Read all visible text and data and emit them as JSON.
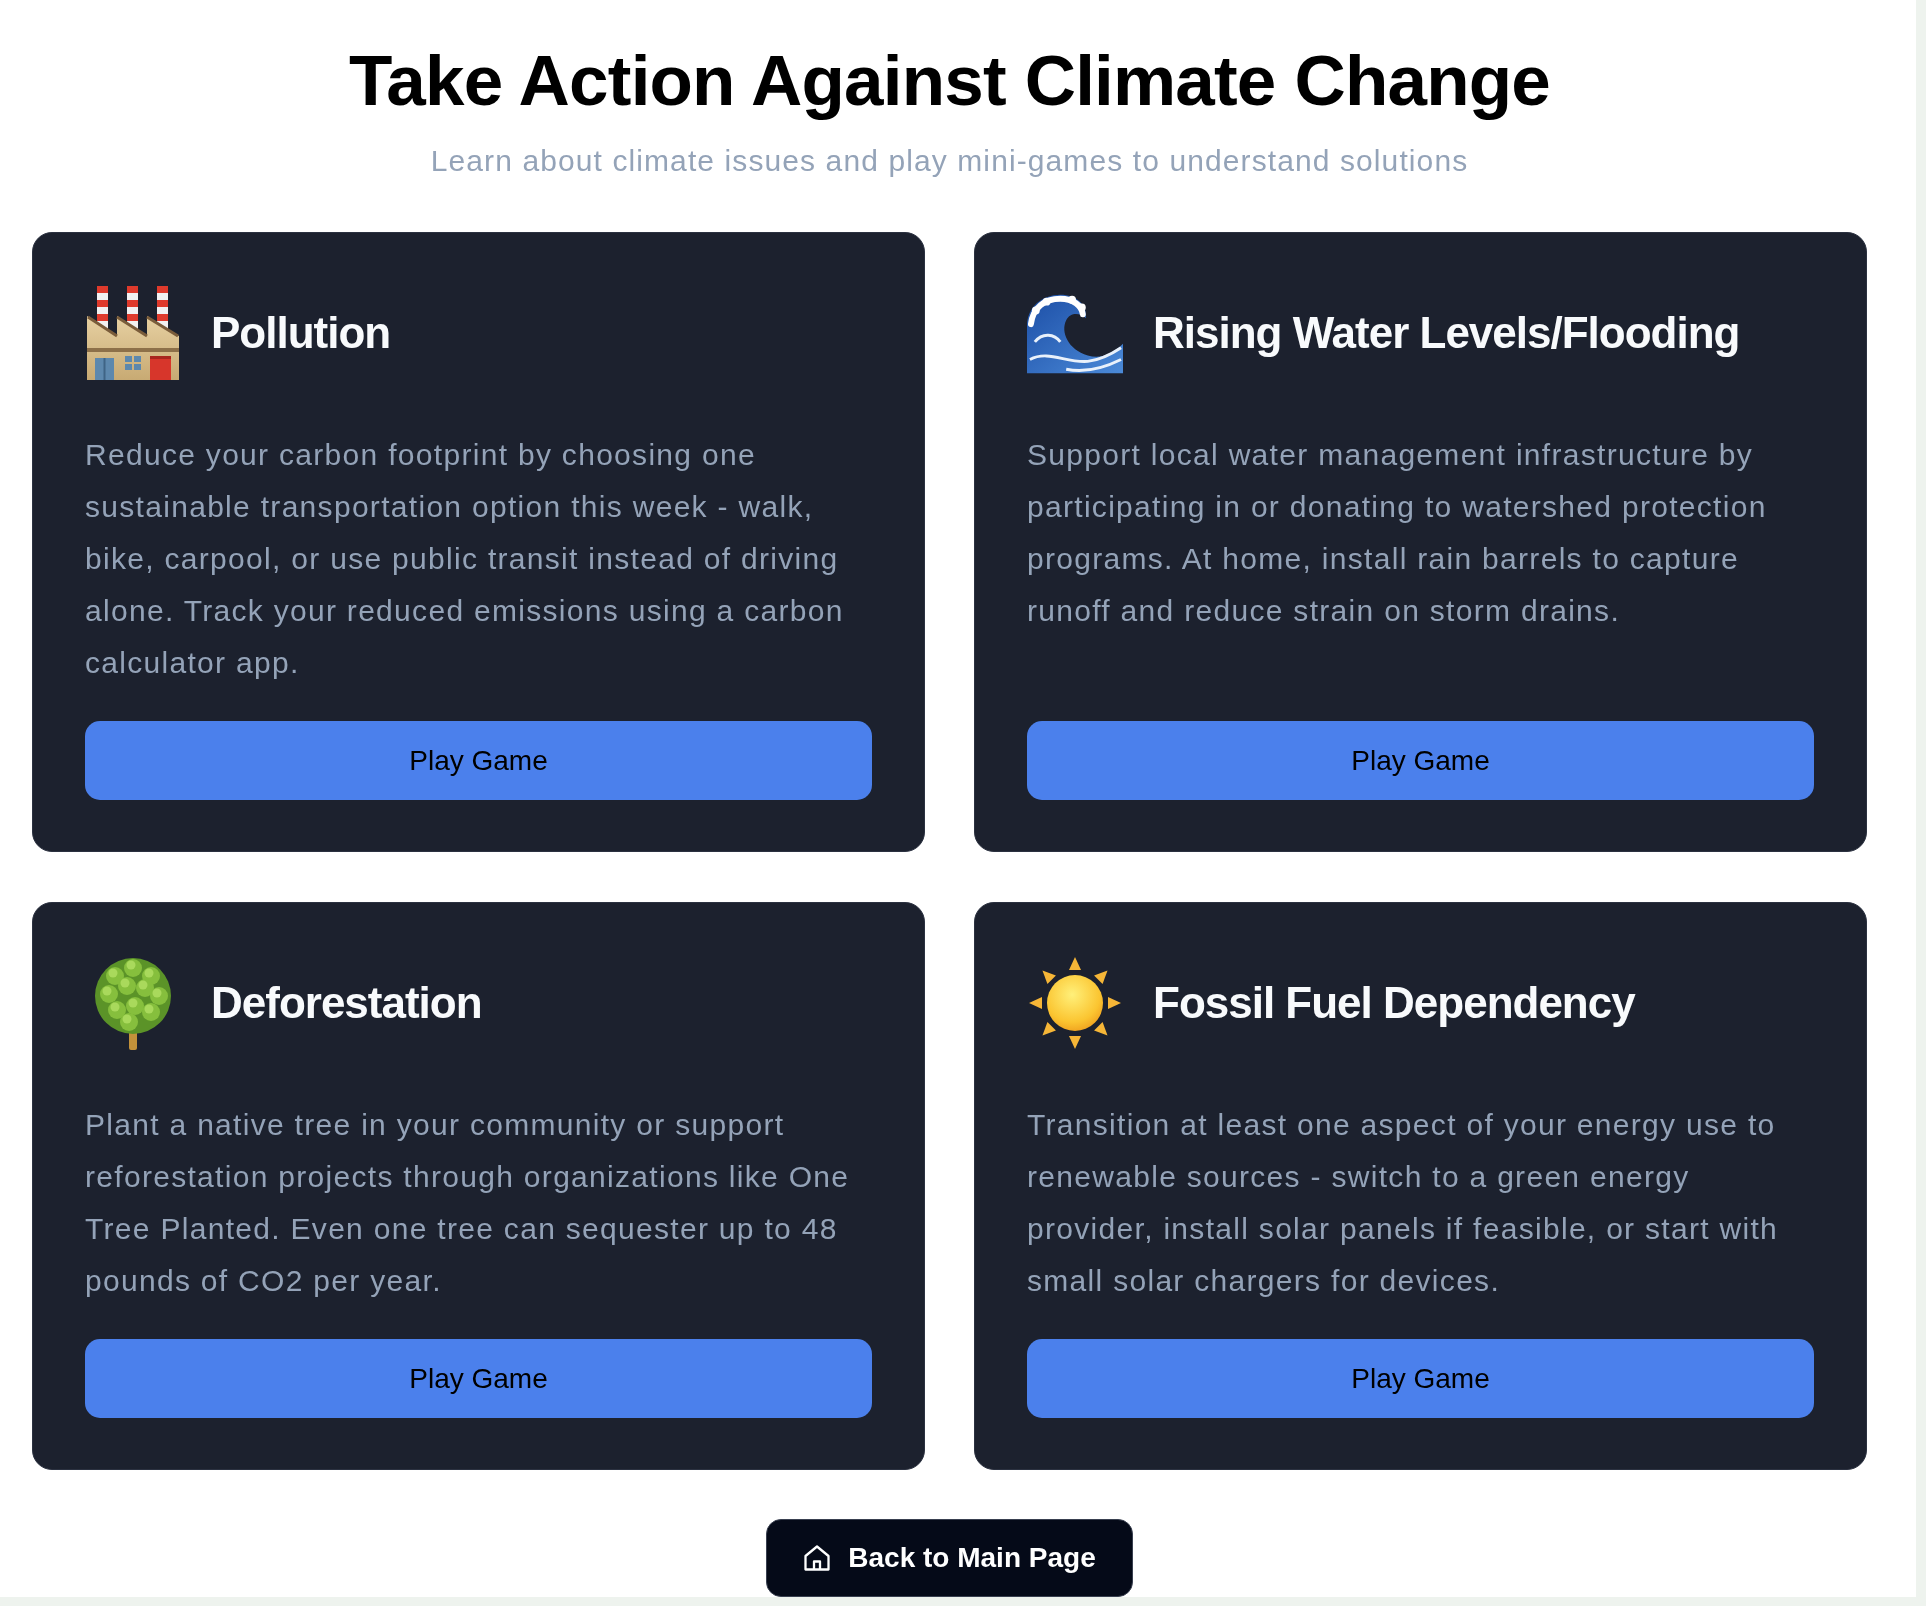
{
  "header": {
    "title": "Take Action Against Climate Change",
    "subtitle": "Learn about climate issues and play mini-games to understand solutions"
  },
  "cards": [
    {
      "kind": "pollution",
      "title": "Pollution",
      "description": "Reduce your carbon footprint by choosing one sustainable transportation option this week - walk, bike, carpool, or use public transit instead of driving alone. Track your reduced emissions using a carbon calculator app.",
      "button": "Play Game"
    },
    {
      "kind": "flooding",
      "title": "Rising Water Levels/Flooding",
      "description": "Support local water management infrastructure by participating in or donating to watershed protection programs. At home, install rain barrels to capture runoff and reduce strain on storm drains.",
      "button": "Play Game"
    },
    {
      "kind": "deforestation",
      "title": "Deforestation",
      "description": "Plant a native tree in your community or support reforestation projects through organizations like One Tree Planted. Even one tree can sequester up to 48 pounds of CO2 per year.",
      "button": "Play Game"
    },
    {
      "kind": "energy",
      "title": "Fossil Fuel Dependency",
      "description": "Transition at least one aspect of your energy use to renewable sources - switch to a green energy provider, install solar panels if feasible, or start with small solar chargers for devices.",
      "button": "Play Game"
    }
  ],
  "back_button": {
    "label": "Back to Main Page"
  }
}
